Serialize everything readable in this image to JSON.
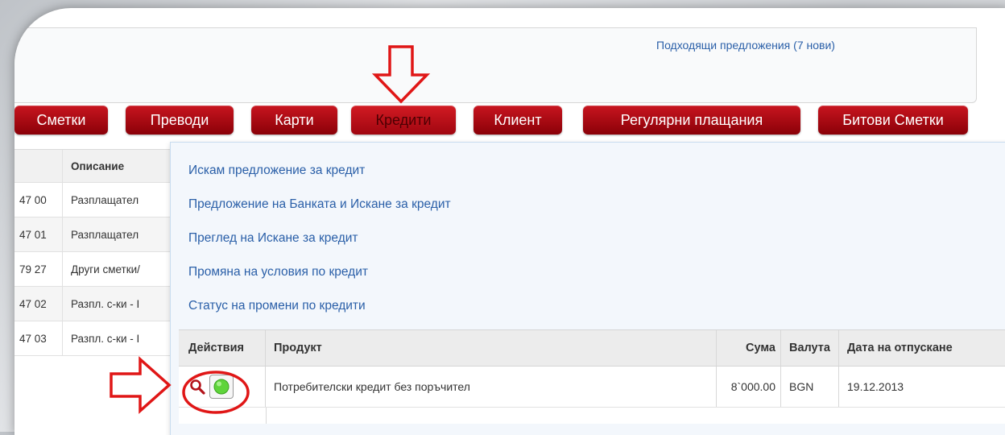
{
  "header": {
    "offers_link": "Подходящи предложения (7 нови)"
  },
  "nav": {
    "tabs": [
      {
        "label": "Сметки"
      },
      {
        "label": "Преводи"
      },
      {
        "label": "Карти"
      },
      {
        "label": "Кредити"
      },
      {
        "label": "Клиент"
      },
      {
        "label": "Регулярни плащания"
      },
      {
        "label": "Битови Сметки"
      }
    ],
    "active_color": "#b30d16"
  },
  "accounts_table": {
    "header": {
      "col2": "Описание"
    },
    "rows": [
      {
        "num": "47 00",
        "desc": "Разплащател"
      },
      {
        "num": "47 01",
        "desc": "Разплащател"
      },
      {
        "num": "79 27",
        "desc": "Други сметки/"
      },
      {
        "num": "47 02",
        "desc": "Разпл. с-ки - I"
      },
      {
        "num": "47 03",
        "desc": "Разпл. с-ки - I"
      }
    ]
  },
  "credits_menu": {
    "items": [
      "Искам предложение за кредит",
      "Предложение на Банката и Искане за кредит",
      "Преглед на Искане за кредит",
      "Промяна на условия по кредит",
      "Статус на промени по кредити"
    ]
  },
  "credits_table": {
    "columns": {
      "actions": "Действия",
      "product": "Продукт",
      "amount": "Сума",
      "currency": "Валута",
      "date": "Дата на отпускане"
    },
    "rows": [
      {
        "product": "Потребителски кредит без поръчител",
        "amount": "8`000.00",
        "currency": "BGN",
        "date": "19.12.2013"
      }
    ]
  },
  "icons": {
    "view": "magnifier-icon",
    "status": "green-status-icon"
  },
  "colors": {
    "annotation": "#e01616",
    "link": "#2a5fa8",
    "tab": "#b30d16"
  }
}
